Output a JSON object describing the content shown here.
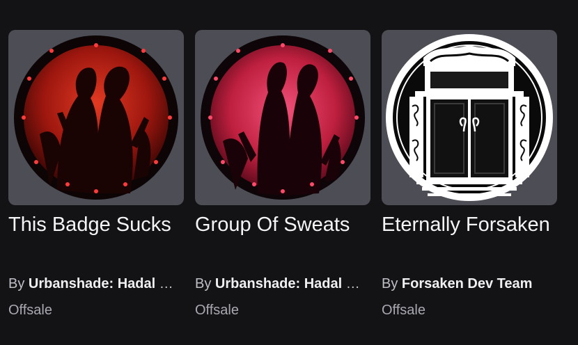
{
  "badges": [
    {
      "title": "This Badge Sucks",
      "by": "By",
      "creator": "Urbanshade: Hadal Blacksite",
      "price": "Offsale",
      "icon": "shadow-figures-red-icon",
      "accent": "#c2241a"
    },
    {
      "title": "Group Of Sweats",
      "by": "By",
      "creator": "Urbanshade: Hadal Blacksite",
      "price": "Offsale",
      "icon": "shadow-figures-pink-icon",
      "accent": "#e0355a"
    },
    {
      "title": "Eternally Forsaken",
      "by": "By",
      "creator": "Forsaken Dev Team",
      "price": "Offsale",
      "icon": "gothic-doors-icon",
      "accent": "#ffffff"
    }
  ]
}
